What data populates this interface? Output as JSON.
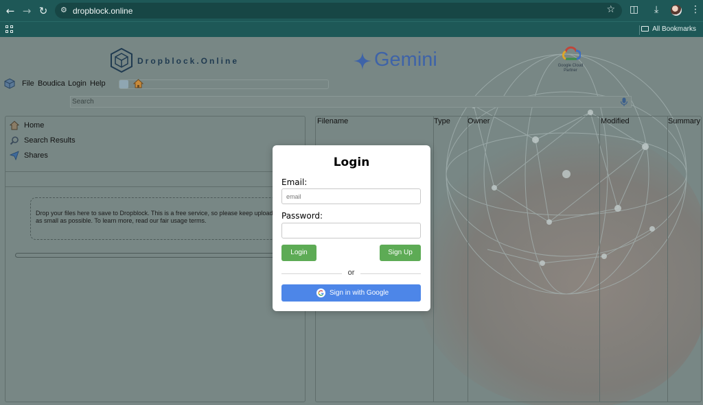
{
  "browser": {
    "url": "dropblock.online",
    "bookmarks_label": "All Bookmarks"
  },
  "branding": {
    "dropblock_name": "Dropblock.Online",
    "gemini_name": "Gemini",
    "gcloud_text": "Google Cloud Partner"
  },
  "menu": {
    "items": [
      "File",
      "Boudica",
      "Login",
      "Help"
    ]
  },
  "search": {
    "placeholder": "Search"
  },
  "sidebar": {
    "items": [
      {
        "label": "Home",
        "icon": "home-icon"
      },
      {
        "label": "Search Results",
        "icon": "magnifier-icon"
      },
      {
        "label": "Shares",
        "icon": "paper-plane-icon"
      }
    ]
  },
  "dropzone": {
    "text": "Drop your files here to save to Dropblock. This is a free service, so please keep uploads as small as possible. To learn more, read our fair usage terms."
  },
  "upload_progress": 0,
  "file_table": {
    "columns": [
      "Filename",
      "Type",
      "Owner",
      "Modified",
      "Summary"
    ]
  },
  "login_modal": {
    "title": "Login",
    "email_label": "Email:",
    "email_placeholder": "email",
    "password_label": "Password:",
    "login_button": "Login",
    "signup_button": "Sign Up",
    "divider_text": "or",
    "google_button": "Sign in with Google"
  },
  "colors": {
    "chrome": "#1e5857",
    "primary_green": "#5dab55",
    "google_blue": "#4d86e8",
    "overlay": "#788785"
  }
}
